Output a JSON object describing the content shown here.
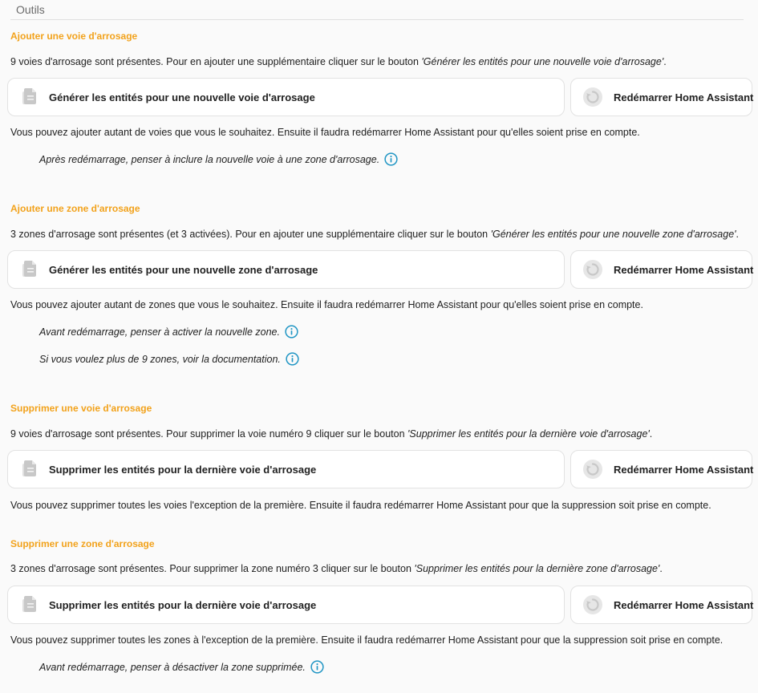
{
  "header": {
    "title": "Outils"
  },
  "colors": {
    "accent": "#f2a21b",
    "info": "#2196c4",
    "icon_grey": "#c8c8c8"
  },
  "sections": [
    {
      "title": "Ajouter une voie d'arrosage",
      "description_prefix": "9 voies d'arrosage sont présentes. Pour en ajouter une supplémentaire cliquer sur le bouton ",
      "description_quote": "'Générer les entités pour une nouvelle voie d'arrosage'",
      "description_suffix": ".",
      "action_button": {
        "label": "Générer les entités pour une nouvelle voie d'arrosage",
        "icon": "file-copy-icon"
      },
      "restart_button": {
        "label": "Redémarrer Home Assistant",
        "icon": "restart-icon"
      },
      "followup": "Vous pouvez ajouter autant de voies que vous le souhaitez. Ensuite il faudra redémarrer Home Assistant pour qu'elles soient prise en compte.",
      "notes": [
        "Après redémarrage, penser à inclure la nouvelle voie à une zone d'arrosage."
      ]
    },
    {
      "title": "Ajouter une zone d'arrosage",
      "description_prefix": "3 zones d'arrosage sont présentes (et 3 activées). Pour en ajouter une supplémentaire cliquer sur le bouton ",
      "description_quote": "'Générer les entités pour une nouvelle zone d'arrosage'",
      "description_suffix": ".",
      "action_button": {
        "label": "Générer les entités pour une nouvelle zone d'arrosage",
        "icon": "file-copy-icon"
      },
      "restart_button": {
        "label": "Redémarrer Home Assistant",
        "icon": "restart-icon"
      },
      "followup": "Vous pouvez ajouter autant de zones que vous le souhaitez. Ensuite il faudra redémarrer Home Assistant pour qu'elles soient prise en compte.",
      "notes": [
        "Avant redémarrage, penser à activer la nouvelle zone.",
        "Si vous voulez plus de 9 zones, voir la documentation."
      ]
    },
    {
      "title": "Supprimer une voie d'arrosage",
      "description_prefix": "9 voies d'arrosage sont présentes. Pour supprimer la voie numéro 9 cliquer sur le bouton ",
      "description_quote": "'Supprimer les entités pour la dernière voie d'arrosage'",
      "description_suffix": ".",
      "action_button": {
        "label": "Supprimer les entités pour la dernière voie d'arrosage",
        "icon": "file-copy-icon"
      },
      "restart_button": {
        "label": "Redémarrer Home Assistant",
        "icon": "restart-icon"
      },
      "followup": "Vous pouvez supprimer toutes les voies l'exception de la première. Ensuite il faudra redémarrer Home Assistant pour que la suppression soit prise en compte.",
      "notes": []
    },
    {
      "title": "Supprimer une zone d'arrosage",
      "description_prefix": "3 zones d'arrosage sont présentes. Pour supprimer la zone numéro 3 cliquer sur le bouton ",
      "description_quote": "'Supprimer les entités pour la dernière zone d'arrosage'",
      "description_suffix": ".",
      "action_button": {
        "label": "Supprimer les entités pour la dernière voie d'arrosage",
        "icon": "file-copy-icon"
      },
      "restart_button": {
        "label": "Redémarrer Home Assistant",
        "icon": "restart-icon"
      },
      "followup": "Vous pouvez supprimer toutes les zones à l'exception de la première. Ensuite il faudra redémarrer Home Assistant pour que la suppression soit prise en compte.",
      "notes": [
        "Avant redémarrage, penser à désactiver la zone supprimée."
      ]
    }
  ]
}
